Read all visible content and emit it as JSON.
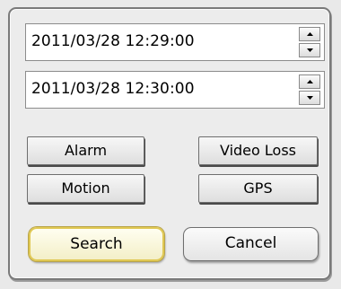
{
  "start_datetime": "2011/03/28 12:29:00",
  "end_datetime": "2011/03/28 12:30:00",
  "buttons": {
    "alarm": "Alarm",
    "video_loss": "Video Loss",
    "motion": "Motion",
    "gps": "GPS",
    "search": "Search",
    "cancel": "Cancel"
  },
  "colors": {
    "search_border": "#e0c853",
    "frame_border": "#7a7a7a"
  }
}
